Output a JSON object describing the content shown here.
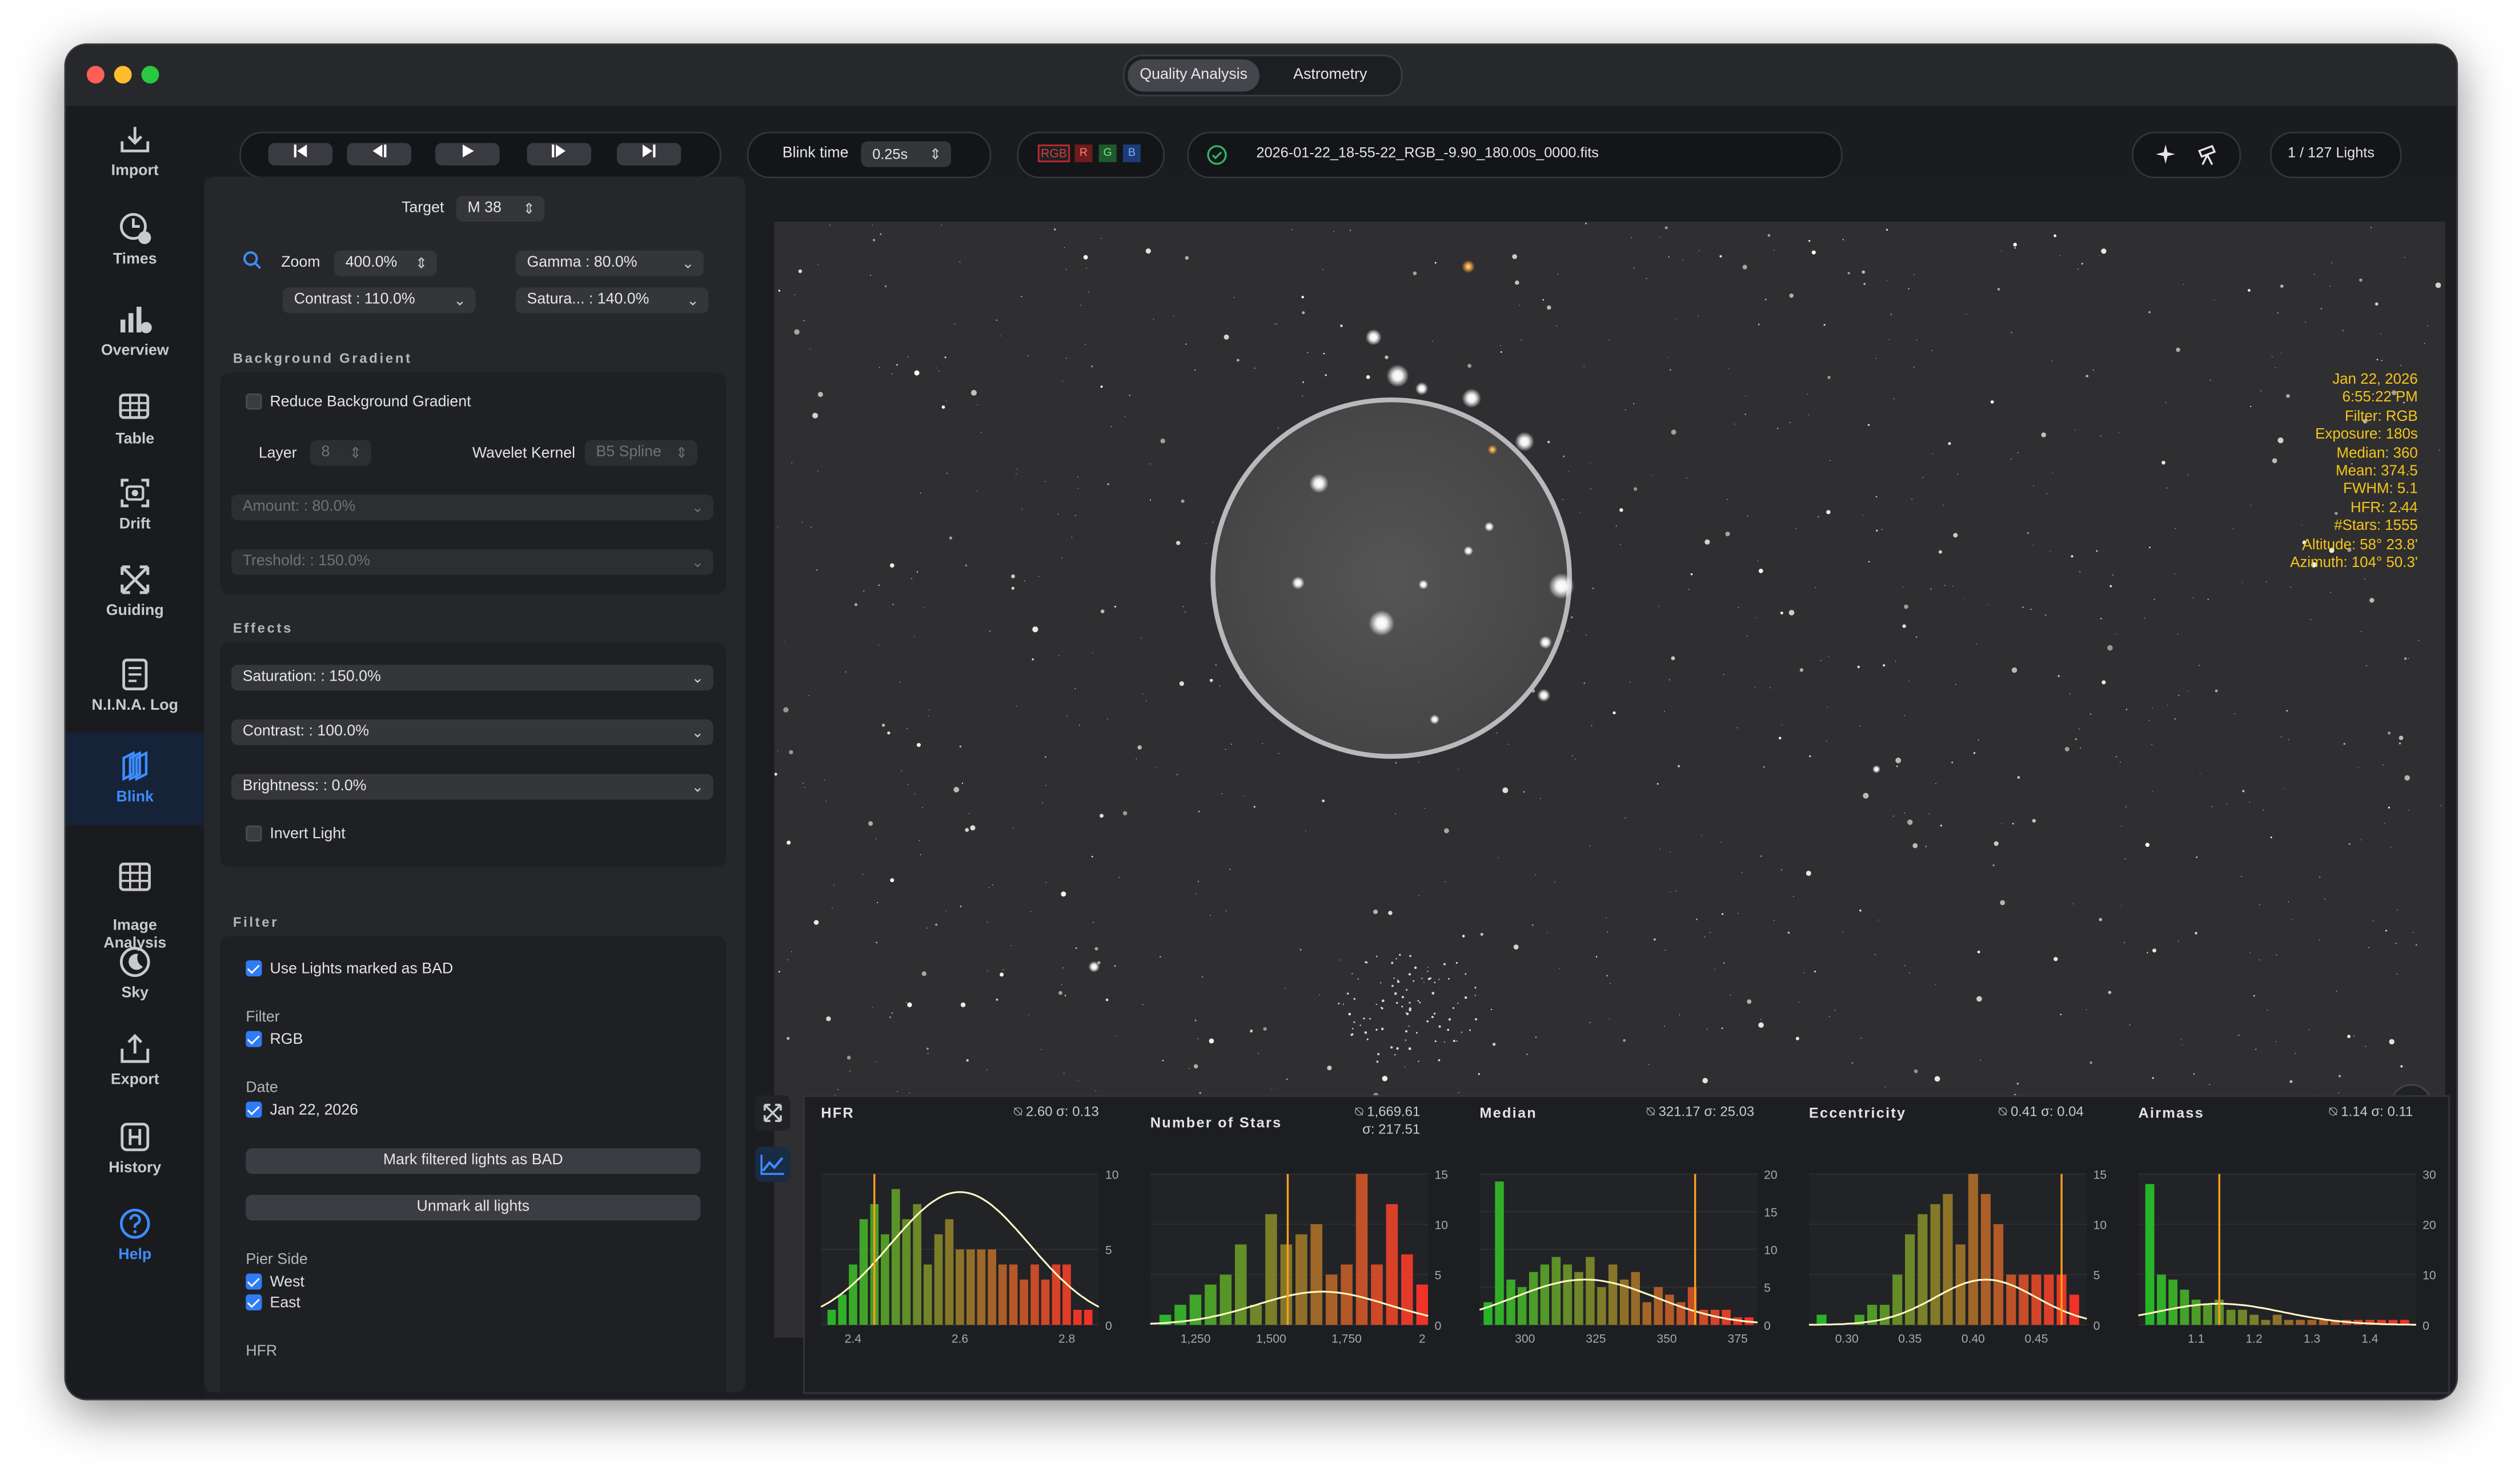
{
  "window": {
    "tabs": [
      {
        "label": "Quality Analysis",
        "active": true
      },
      {
        "label": "Astrometry",
        "active": false
      }
    ]
  },
  "sidebar": {
    "items": [
      {
        "label": "Import",
        "icon": "import-icon"
      },
      {
        "label": "Times",
        "icon": "times-icon"
      },
      {
        "label": "Overview",
        "icon": "overview-icon"
      },
      {
        "label": "Table",
        "icon": "table-icon"
      },
      {
        "label": "Drift",
        "icon": "drift-icon"
      },
      {
        "label": "Guiding",
        "icon": "guiding-icon"
      },
      {
        "label": "N.I.N.A. Log",
        "icon": "log-icon"
      },
      {
        "label": "Blink",
        "icon": "blink-icon",
        "active": true
      },
      {
        "label": "Image\nAnalysis",
        "icon": "image-analysis-icon"
      },
      {
        "label": "Sky",
        "icon": "sky-icon"
      },
      {
        "label": "Export",
        "icon": "export-icon"
      },
      {
        "label": "History",
        "icon": "history-icon"
      },
      {
        "label": "Help",
        "icon": "help-icon"
      }
    ]
  },
  "toolbar": {
    "blink_time_label": "Blink time",
    "blink_time_value": "0.25s",
    "channels": [
      "RGB",
      "R",
      "G",
      "B"
    ],
    "filename": "2026-01-22_18-55-22_RGB_-9.90_180.00s_0000.fits",
    "counter": "1 /  127 Lights"
  },
  "panel": {
    "target_label": "Target",
    "target_value": "M 38",
    "zoom_label": "Zoom",
    "zoom_value": "400.0%",
    "gamma": "Gamma   : 80.0%",
    "contrast": "Contrast  : 110.0%",
    "saturation_top": "Satura...  : 140.0%",
    "bg_section": "Background Gradient",
    "reduce_bg": "Reduce Background Gradient",
    "layer_label": "Layer",
    "layer_value": "8",
    "wavelet_label": "Wavelet Kernel",
    "wavelet_value": "B5 Spline",
    "amount": "Amount:   : 80.0%",
    "threshold": "Treshold:  : 150.0%",
    "effects_section": "Effects",
    "eff_saturation": "Saturation:  : 150.0%",
    "eff_contrast": "Contrast:  : 100.0%",
    "eff_brightness": "Brightness:   :  0.0%",
    "invert_light": "Invert Light",
    "filter_section": "Filter",
    "use_bad": "Use Lights marked as BAD",
    "filter_label": "Filter",
    "filter_rgb": "RGB",
    "date_label": "Date",
    "date_value": "Jan 22, 2026",
    "mark_bad_btn": "Mark filtered lights as BAD",
    "unmark_btn": "Unmark all lights",
    "pier_label": "Pier Side",
    "pier_west": "West",
    "pier_east": "East",
    "hfr_label": "HFR"
  },
  "image_info": {
    "lines": [
      "Jan 22, 2026",
      "6:55:22 PM",
      "Filter: RGB",
      "Exposure: 180s",
      "Median: 360",
      "Mean: 374.5",
      "FWHM: 5.1",
      "HFR: 2.44",
      "#Stars: 1555",
      "Altitude: 58° 23.8'",
      "Azimuth: 104° 50.3'"
    ]
  },
  "colors": {
    "accent": "#2f7cf6",
    "info_text": "#f5c518",
    "current_line": "#ff9f1c",
    "curve": "#fff8c4"
  },
  "chart_data": [
    {
      "type": "bar",
      "title": "HFR",
      "stat": "2.60  σ: 0.13",
      "mean": 2.6,
      "sigma": 0.13,
      "current": 2.44,
      "x": [
        2.36,
        2.38,
        2.4,
        2.42,
        2.44,
        2.46,
        2.48,
        2.5,
        2.52,
        2.54,
        2.56,
        2.58,
        2.6,
        2.62,
        2.64,
        2.66,
        2.68,
        2.7,
        2.72,
        2.74,
        2.76,
        2.78,
        2.8,
        2.82,
        2.84
      ],
      "values": [
        1,
        2,
        4,
        7,
        8,
        6,
        9,
        7,
        8,
        4,
        6,
        7,
        5,
        5,
        5,
        5,
        4,
        4,
        3,
        4,
        3,
        4,
        4,
        1,
        1
      ],
      "xlim": [
        2.34,
        2.86
      ],
      "ylim": [
        0,
        10
      ],
      "xticks": [
        2.4,
        2.6,
        2.8
      ],
      "yticks": [
        0,
        5,
        10
      ]
    },
    {
      "type": "bar",
      "title": "Number of Stars",
      "stat": "1,669.61\nσ: 217.51",
      "mean": 1669.61,
      "sigma": 217.51,
      "current": 1555,
      "x": [
        1150,
        1200,
        1250,
        1300,
        1350,
        1400,
        1450,
        1500,
        1550,
        1600,
        1650,
        1700,
        1750,
        1800,
        1850,
        1900,
        1950,
        2000
      ],
      "values": [
        1,
        2,
        3,
        4,
        5,
        8,
        2,
        11,
        8,
        9,
        10,
        5,
        6,
        15,
        6,
        12,
        7,
        4
      ],
      "xlim": [
        1100,
        2020
      ],
      "ylim": [
        0,
        15
      ],
      "xticks": [
        1250,
        1500,
        1750,
        2000
      ],
      "xticklabels": [
        "1,250",
        "1,500",
        "1,750",
        "2"
      ],
      "yticks": [
        0,
        5,
        10,
        15
      ]
    },
    {
      "type": "bar",
      "title": "Median",
      "stat": "321.17  σ: 25.03",
      "mean": 321.17,
      "sigma": 25.03,
      "current": 360,
      "x": [
        287,
        291,
        295,
        299,
        303,
        307,
        311,
        315,
        319,
        323,
        327,
        331,
        335,
        339,
        343,
        347,
        351,
        355,
        359,
        363,
        367,
        371,
        375,
        379
      ],
      "values": [
        3,
        19,
        6,
        5,
        7,
        8,
        9,
        8,
        7,
        9,
        5,
        8,
        6,
        7,
        3,
        5,
        4,
        3,
        5,
        2,
        2,
        2,
        1,
        1
      ],
      "xlim": [
        284,
        382
      ],
      "ylim": [
        0,
        20
      ],
      "xticks": [
        300,
        325,
        350,
        375
      ],
      "yticks": [
        0,
        5,
        10,
        15,
        20
      ]
    },
    {
      "type": "bar",
      "title": "Eccentricity",
      "stat": "0.41  σ: 0.04",
      "mean": 0.41,
      "sigma": 0.04,
      "current": 0.47,
      "x": [
        0.28,
        0.29,
        0.3,
        0.31,
        0.32,
        0.33,
        0.34,
        0.35,
        0.36,
        0.37,
        0.38,
        0.39,
        0.4,
        0.41,
        0.42,
        0.43,
        0.44,
        0.45,
        0.46,
        0.47,
        0.48
      ],
      "values": [
        1,
        0,
        0,
        1,
        2,
        2,
        5,
        9,
        11,
        12,
        13,
        8,
        15,
        13,
        10,
        5,
        5,
        5,
        5,
        5,
        3
      ],
      "xlim": [
        0.27,
        0.49
      ],
      "ylim": [
        0,
        15
      ],
      "xticks": [
        0.3,
        0.35,
        0.4,
        0.45
      ],
      "yticks": [
        0,
        5,
        10,
        15
      ]
    },
    {
      "type": "bar",
      "title": "Airmass",
      "stat": "1.14  σ: 0.11",
      "mean": 1.14,
      "sigma": 0.11,
      "current": 1.14,
      "x": [
        1.02,
        1.04,
        1.06,
        1.08,
        1.1,
        1.12,
        1.14,
        1.16,
        1.18,
        1.2,
        1.22,
        1.24,
        1.26,
        1.28,
        1.3,
        1.32,
        1.34,
        1.36,
        1.38,
        1.4,
        1.42,
        1.44,
        1.46
      ],
      "values": [
        28,
        10,
        9,
        7,
        5,
        4,
        5,
        3,
        3,
        2,
        1,
        2,
        1,
        1,
        1,
        1,
        1,
        1,
        1,
        1,
        1,
        1,
        1
      ],
      "xlim": [
        1.0,
        1.48
      ],
      "ylim": [
        0,
        30
      ],
      "xticks": [
        1.1,
        1.2,
        1.3,
        1.4
      ],
      "yticks": [
        0,
        10,
        20,
        30
      ]
    }
  ]
}
